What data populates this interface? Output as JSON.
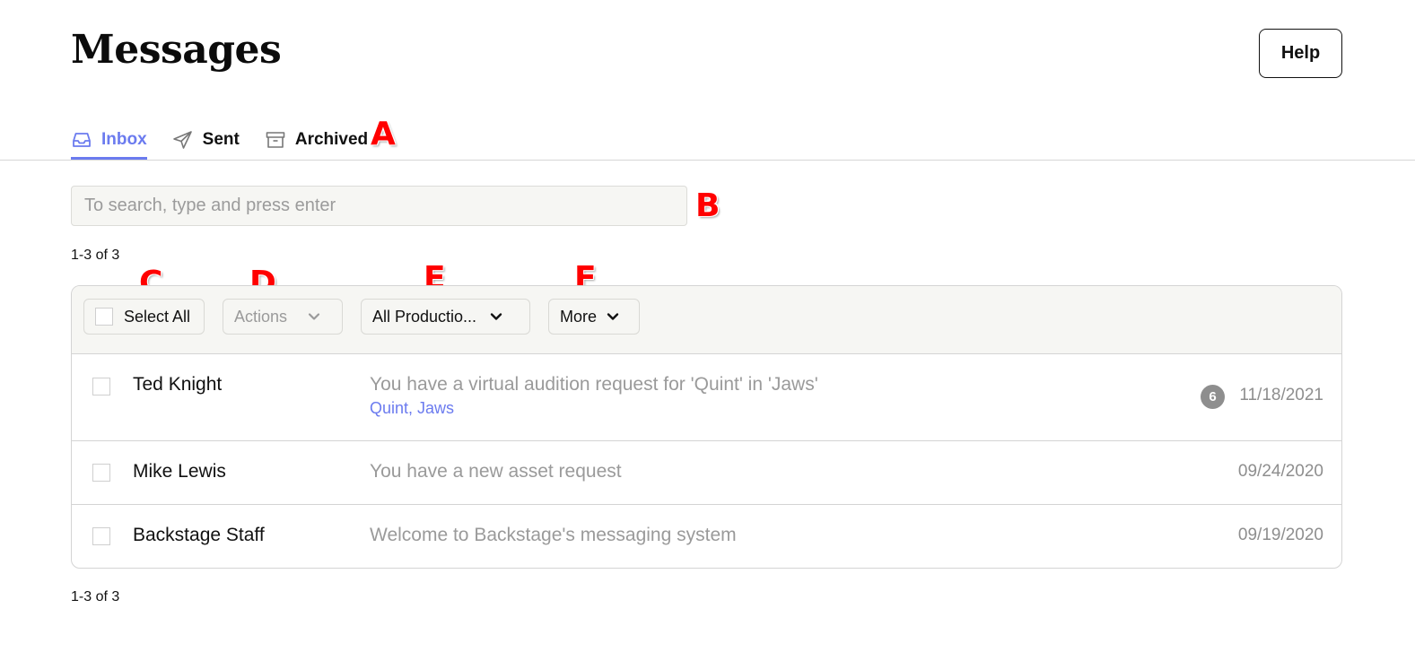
{
  "header": {
    "title": "Messages",
    "help_label": "Help"
  },
  "tabs": [
    {
      "label": "Inbox",
      "icon": "inbox-icon",
      "active": true
    },
    {
      "label": "Sent",
      "icon": "send-icon",
      "active": false
    },
    {
      "label": "Archived",
      "icon": "archive-icon",
      "active": false
    }
  ],
  "search": {
    "value": "",
    "placeholder": "To search, type and press enter"
  },
  "pagination": {
    "top": "1-3 of 3",
    "bottom": "1-3 of 3"
  },
  "toolbar": {
    "select_all_label": "Select All",
    "actions_label": "Actions",
    "productions_label": "All Productio...",
    "more_label": "More"
  },
  "messages": [
    {
      "sender": "Ted Knight",
      "subject": "You have a virtual audition request for 'Quint' in 'Jaws'",
      "tag": "Quint, Jaws",
      "badge": "6",
      "date": "11/18/2021"
    },
    {
      "sender": "Mike Lewis",
      "subject": "You have a new asset request",
      "tag": "",
      "badge": "",
      "date": "09/24/2020"
    },
    {
      "sender": "Backstage Staff",
      "subject": "Welcome to Backstage's messaging system",
      "tag": "",
      "badge": "",
      "date": "09/19/2020"
    }
  ],
  "annotations": {
    "a": "A",
    "b": "B",
    "c": "C",
    "d": "D",
    "e": "E",
    "f": "F"
  },
  "colors": {
    "accent": "#6b7bef",
    "toolbar_bg": "#f6f6f3",
    "muted_text": "#9a9a9a",
    "badge_bg": "#8e8e8e",
    "marker": "#ff0000"
  }
}
